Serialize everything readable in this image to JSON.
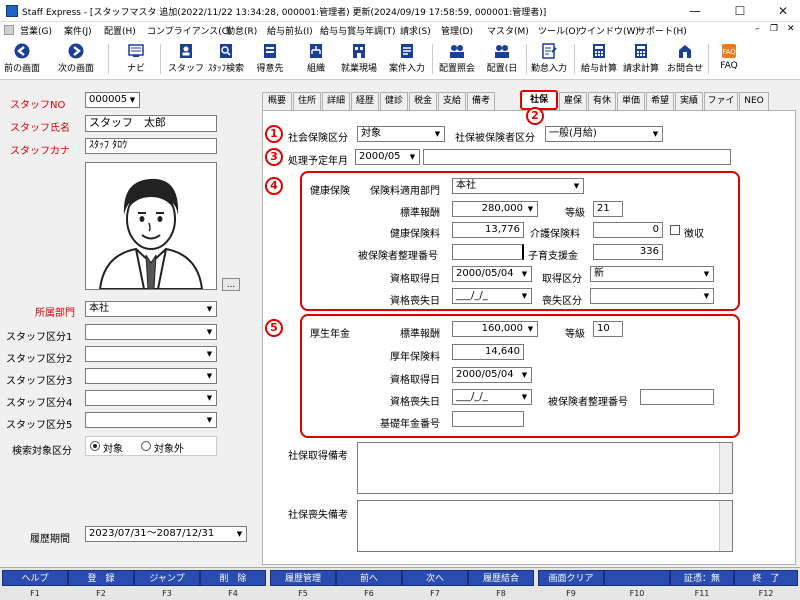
{
  "window": {
    "title": "Staff Express - [スタッフマスタ 追加(2022/11/22 13:34:28, 000001:管理者) 更新(2024/09/19 17:58:59, 000001:管理者)]",
    "minimize": "—",
    "maximize": "☐",
    "close": "✕"
  },
  "menus": [
    "営業(G)",
    "案件(J)",
    "配置(H)",
    "コンプライアンス(C)",
    "勤怠(R)",
    "給与前払(I)",
    "給与与賞与年調(T)",
    "請求(S)",
    "管理(D)",
    "マスタ(M)",
    "ツール(O)",
    "ウインドウ(W)",
    "サポート(H)"
  ],
  "mdi_controls": [
    "–",
    "❐",
    "✕"
  ],
  "toolbar": [
    {
      "label": "前の画面",
      "icon": "arrow-left-icon"
    },
    {
      "label": "次の画面",
      "icon": "arrow-right-icon"
    },
    {
      "label": "ナビ",
      "icon": "navi-icon"
    },
    {
      "label": "スタッフ",
      "icon": "staff-icon"
    },
    {
      "label": "ｽﾀｯﾌ検索",
      "icon": "staff-search-icon"
    },
    {
      "label": "得意先",
      "icon": "client-icon"
    },
    {
      "label": "組織",
      "icon": "org-icon"
    },
    {
      "label": "就業現場",
      "icon": "worksite-icon"
    },
    {
      "label": "案件入力",
      "icon": "case-input-icon"
    },
    {
      "label": "配置照会",
      "icon": "placement-query-icon"
    },
    {
      "label": "配置(日",
      "icon": "placement-day-icon"
    },
    {
      "label": "勤怠入力",
      "icon": "attendance-icon"
    },
    {
      "label": "給与計算",
      "icon": "payroll-icon"
    },
    {
      "label": "請求計算",
      "icon": "billing-icon"
    },
    {
      "label": "お問合せ",
      "icon": "inquiry-icon"
    },
    {
      "label": "FAQ",
      "icon": "faq-icon"
    }
  ],
  "left": {
    "staff_no_label": "スタッフNO",
    "staff_no": "000005",
    "staff_name_label": "スタッフ氏名",
    "staff_name": "スタッフ　太郎",
    "staff_kana_label": "スタッフカナ",
    "staff_kana": "ｽﾀｯﾌ ﾀﾛｳ",
    "photo_button": "...",
    "dept_label": "所属部門",
    "dept": "本社",
    "categories": [
      {
        "label": "スタッフ区分1",
        "value": ""
      },
      {
        "label": "スタッフ区分2",
        "value": ""
      },
      {
        "label": "スタッフ区分3",
        "value": ""
      },
      {
        "label": "スタッフ区分4",
        "value": ""
      },
      {
        "label": "スタッフ区分5",
        "value": ""
      }
    ],
    "search_target_label": "検索対象区分",
    "search_target_on": "対象",
    "search_target_off": "対象外",
    "history_label": "履歴期間",
    "history_value": "2023/07/31～2087/12/31"
  },
  "tabs": [
    "概要",
    "住所",
    "詳細",
    "経歴",
    "健診",
    "税金",
    "支給",
    "備考",
    "社保",
    "雇保",
    "有休",
    "単価",
    "希望",
    "実績",
    "ファイル",
    "NEO"
  ],
  "active_tab": "社保",
  "markers": [
    "1",
    "2",
    "3",
    "4",
    "5"
  ],
  "shaho": {
    "kubun_label": "社会保険区分",
    "kubun": "対象",
    "insured_kubun_label": "社保被保険者区分",
    "insured_kubun": "一般(月給)",
    "scheduled_label": "処理予定年月",
    "scheduled": "2000/05",
    "scheduled_note": ""
  },
  "kenko": {
    "section": "健康保険",
    "dept_label": "保険料適用部門",
    "dept": "本社",
    "std_label": "標準報酬",
    "std": "280,000",
    "grade_label": "等級",
    "grade": "21",
    "premium_label": "健康保険料",
    "premium": "13,776",
    "care_label": "介護保険料",
    "care": "0",
    "collect_label": "徴収",
    "insured_no_label": "被保険者整理番号",
    "insured_no": "",
    "child_label": "子育支援金",
    "child": "336",
    "acquire_label": "資格取得日",
    "acquire": "2000/05/04",
    "acquire_kubun_label": "取得区分",
    "acquire_kubun": "新",
    "lose_label": "資格喪失日",
    "lose": "___/_/_",
    "lose_kubun_label": "喪失区分",
    "lose_kubun": ""
  },
  "kosei": {
    "section": "厚生年金",
    "std_label": "標準報酬",
    "std": "160,000",
    "grade_label": "等級",
    "grade": "10",
    "premium_label": "厚年保険料",
    "premium": "14,640",
    "acquire_label": "資格取得日",
    "acquire": "2000/05/04",
    "lose_label": "資格喪失日",
    "lose": "___/_/_",
    "insured_no_label": "被保険者整理番号",
    "insured_no": "",
    "pension_no_label": "基礎年金番号",
    "pension_no": ""
  },
  "remarks": {
    "acquire_label": "社保取得備考",
    "lose_label": "社保喪失備考"
  },
  "fkeys": [
    {
      "label": "ヘルプ",
      "key": "F1"
    },
    {
      "label": "登　録",
      "key": "F2"
    },
    {
      "label": "ジャンプ",
      "key": "F3"
    },
    {
      "label": "削　除",
      "key": "F4"
    },
    {
      "label": "履歴管理",
      "key": "F5"
    },
    {
      "label": "前へ",
      "key": "F6"
    },
    {
      "label": "次へ",
      "key": "F7"
    },
    {
      "label": "履歴結合",
      "key": "F8"
    },
    {
      "label": "画面クリア",
      "key": "F9"
    },
    {
      "label": "",
      "key": "F10"
    },
    {
      "label": "証憑：無",
      "key": "F11"
    },
    {
      "label": "終　了",
      "key": "F12"
    }
  ],
  "colors": {
    "accent_red": "#e00000",
    "fkey_blue": "#2a4bb0"
  }
}
